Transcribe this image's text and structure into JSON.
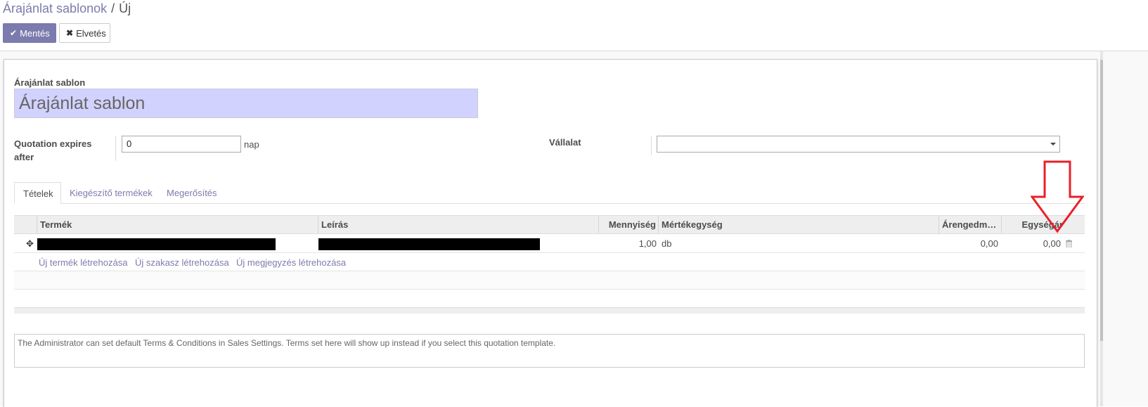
{
  "breadcrumb": {
    "parent": "Árajánlat sablonok",
    "separator": "/",
    "current": "Új"
  },
  "toolbar": {
    "save_label": "Mentés",
    "discard_label": "Elvetés",
    "save_icon": "check-icon",
    "discard_icon": "x-icon"
  },
  "form": {
    "name_label": "Árajánlat sablon",
    "name_placeholder": "Árajánlat sablon",
    "expires_label": "Quotation expires after",
    "expires_value": "0",
    "expires_unit": "nap",
    "company_label": "Vállalat",
    "company_value": ""
  },
  "tabs": [
    {
      "label": "Tételek",
      "active": true
    },
    {
      "label": "Kiegészítő termékek",
      "active": false
    },
    {
      "label": "Megerősítés",
      "active": false
    }
  ],
  "table": {
    "columns": [
      "Termék",
      "Leírás",
      "Mennyiség",
      "Mértékegység",
      "Árengedm…",
      "Egységár"
    ],
    "rows": [
      {
        "product": "",
        "description": "",
        "quantity": "1,00",
        "uom": "db",
        "discount": "0,00",
        "unit_price": "0,00"
      }
    ],
    "add_links": [
      "Új termék létrehozása",
      "Új szakasz létrehozása",
      "Új megjegyzés létrehozása"
    ]
  },
  "notes": {
    "placeholder": "The Administrator can set default Terms & Conditions in Sales Settings. Terms set here will show up instead if you select this quotation template."
  },
  "colors": {
    "accent": "#7c7bad",
    "name_field_bg": "#d2d2ff",
    "annotation": "#e8202a"
  }
}
